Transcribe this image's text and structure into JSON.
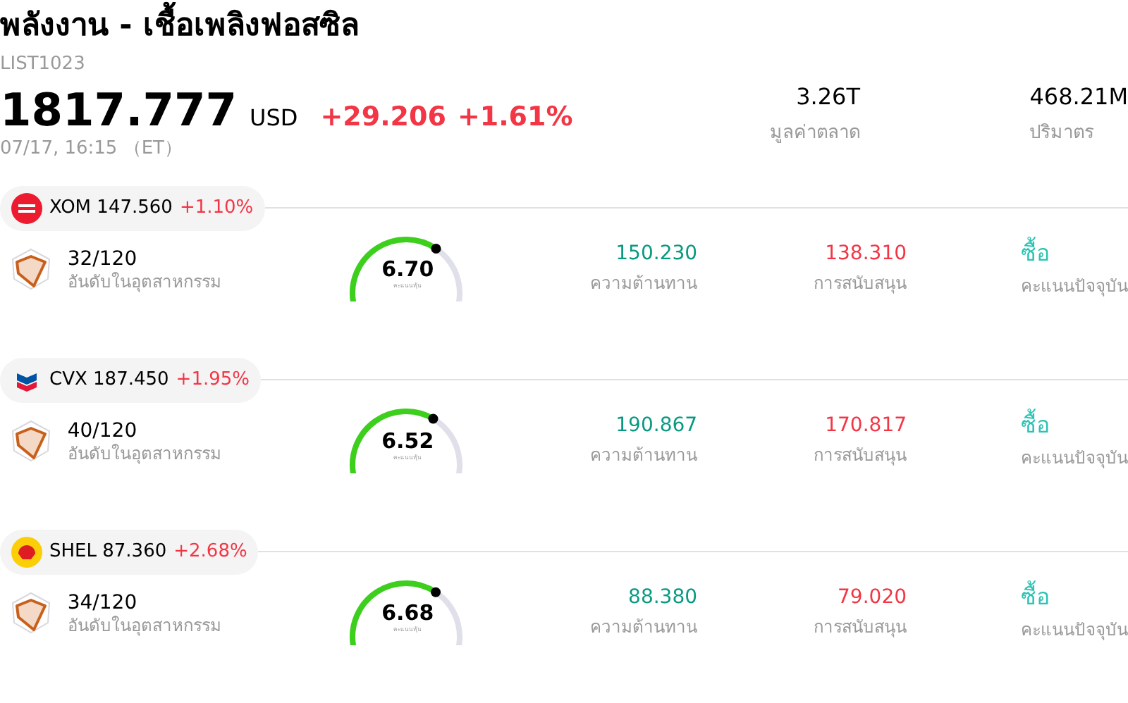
{
  "header": {
    "title": "พลังงาน - เชื้อเพลิงฟอสซิล",
    "code": "LIST1023",
    "price": "1817.777",
    "currency": "USD",
    "change": "+29.206",
    "change_percent": "+1.61%",
    "time": "07/17, 16:15 （ET）"
  },
  "stats": [
    {
      "value": "3.26T",
      "label": "มูลค่าตลาด"
    },
    {
      "value": "468.21M",
      "label": "ปริมาตร"
    }
  ],
  "stocks": [
    {
      "kind": "exxon",
      "symbol": "XOM",
      "price": "147.560",
      "change": "+1.10%",
      "rank": "32/120",
      "rank_label": "อันดับในอุตสาหกรรม",
      "score": "6.70",
      "score_label": "คะแนนหุ้น",
      "resistance": "150.230",
      "resistance_label": "ความต้านทาน",
      "support": "138.310",
      "support_label": "การสนับสนุน",
      "rating": "ซื้อ",
      "rating_label": "คะแนนปัจจุบัน"
    },
    {
      "kind": "chevron",
      "symbol": "CVX",
      "price": "187.450",
      "change": "+1.95%",
      "rank": "40/120",
      "rank_label": "อันดับในอุตสาหกรรม",
      "score": "6.52",
      "score_label": "คะแนนหุ้น",
      "resistance": "190.867",
      "resistance_label": "ความต้านทาน",
      "support": "170.817",
      "support_label": "การสนับสนุน",
      "rating": "ซื้อ",
      "rating_label": "คะแนนปัจจุบัน"
    },
    {
      "kind": "shell",
      "symbol": "SHEL",
      "price": "87.360",
      "change": "+2.68%",
      "rank": "34/120",
      "rank_label": "อันดับในอุตสาหกรรม",
      "score": "6.68",
      "score_label": "คะแนนหุ้น",
      "resistance": "88.380",
      "resistance_label": "ความต้านทาน",
      "support": "79.020",
      "support_label": "การสนับสนุน",
      "rating": "ซื้อ",
      "rating_label": "คะแนนปัจจุบัน"
    }
  ]
}
